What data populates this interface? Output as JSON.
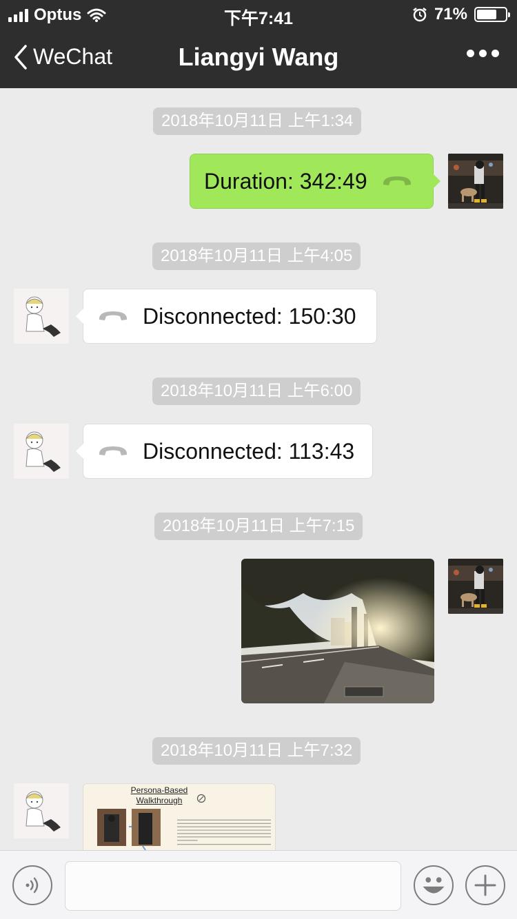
{
  "status_bar": {
    "carrier": "Optus",
    "time": "下午7:41",
    "battery": "71%",
    "battery_level": 0.71
  },
  "nav": {
    "back_label": "WeChat",
    "title": "Liangyi Wang"
  },
  "messages": [
    {
      "timestamp": "2018年10月11日 上午1:34",
      "direction": "out",
      "type": "call",
      "text": "Duration: 342:49"
    },
    {
      "timestamp": "2018年10月11日 上午4:05",
      "direction": "in",
      "type": "call",
      "text": "Disconnected: 150:30"
    },
    {
      "timestamp": "2018年10月11日 上午6:00",
      "direction": "in",
      "type": "call",
      "text": "Disconnected: 113:43"
    },
    {
      "timestamp": "2018年10月11日 上午7:15",
      "direction": "out",
      "type": "image"
    },
    {
      "timestamp": "2018年10月11日 上午7:32",
      "direction": "in",
      "type": "document",
      "title_line1": "Persona-Based",
      "title_line2": "Walkthrough"
    }
  ],
  "icons": {
    "back": "chevron-left-icon",
    "more": "more-dots-icon",
    "voice": "voice-icon",
    "emoji": "emoji-icon",
    "add": "plus-icon",
    "call": "phone-handset-icon"
  },
  "colors": {
    "nav_bg": "#2e2e2f",
    "chat_bg": "#ebebeb",
    "outgoing_bubble": "#a0e75a",
    "incoming_bubble": "#ffffff",
    "timestamp_bg": "#cecece"
  }
}
